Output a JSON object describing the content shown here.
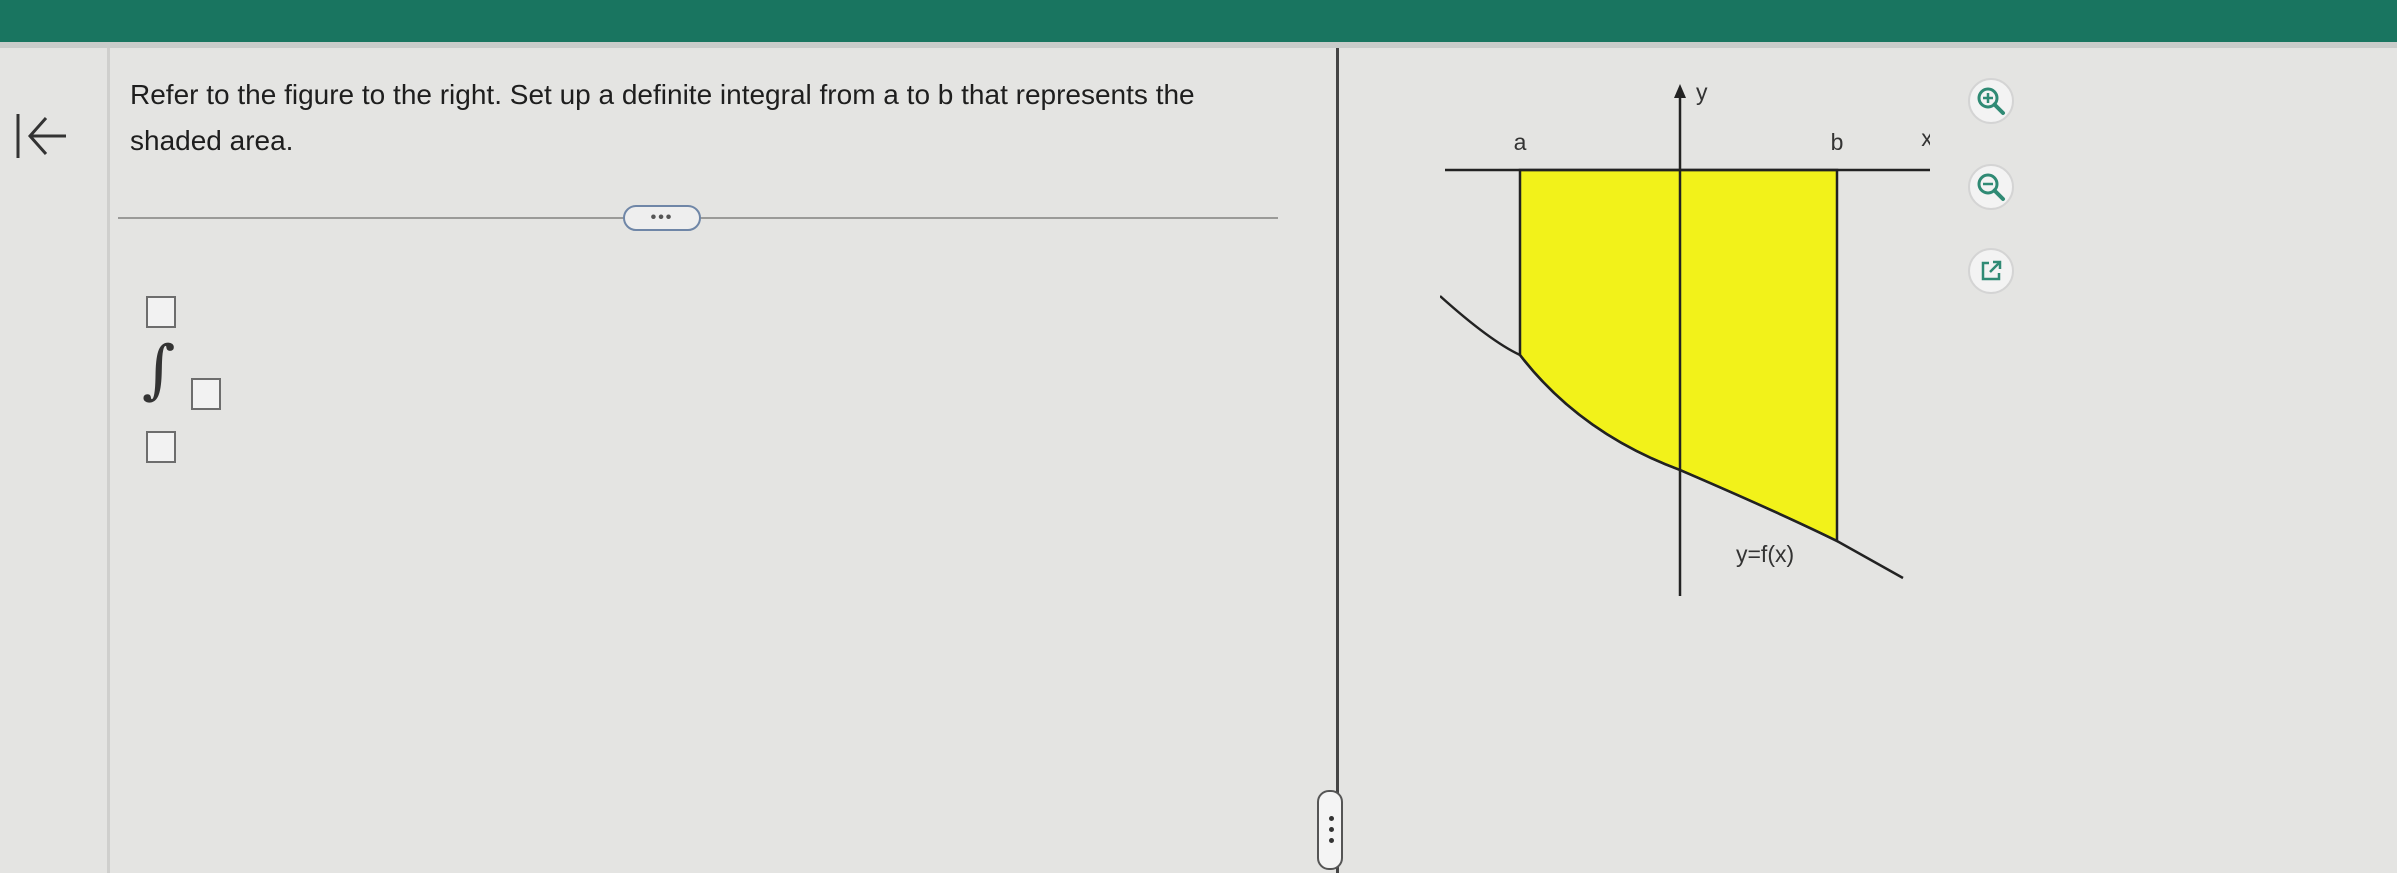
{
  "question": {
    "text": "Refer to the figure to the right. Set up a definite integral from a to b that represents the shaded area."
  },
  "expand_button": {
    "label": "•••"
  },
  "integral": {
    "upper_limit": "",
    "lower_limit": "",
    "integrand": ""
  },
  "figure": {
    "label_a": "a",
    "label_b": "b",
    "label_x": "x",
    "label_y": "y",
    "label_curve": "y=f(x)",
    "shade_color": "#f2f21a"
  },
  "tools": {
    "zoom_in": "zoom-in-icon",
    "zoom_out": "zoom-out-icon",
    "popout": "popout-icon"
  },
  "colors": {
    "topbar": "#197560",
    "accent": "#2f8a74"
  }
}
